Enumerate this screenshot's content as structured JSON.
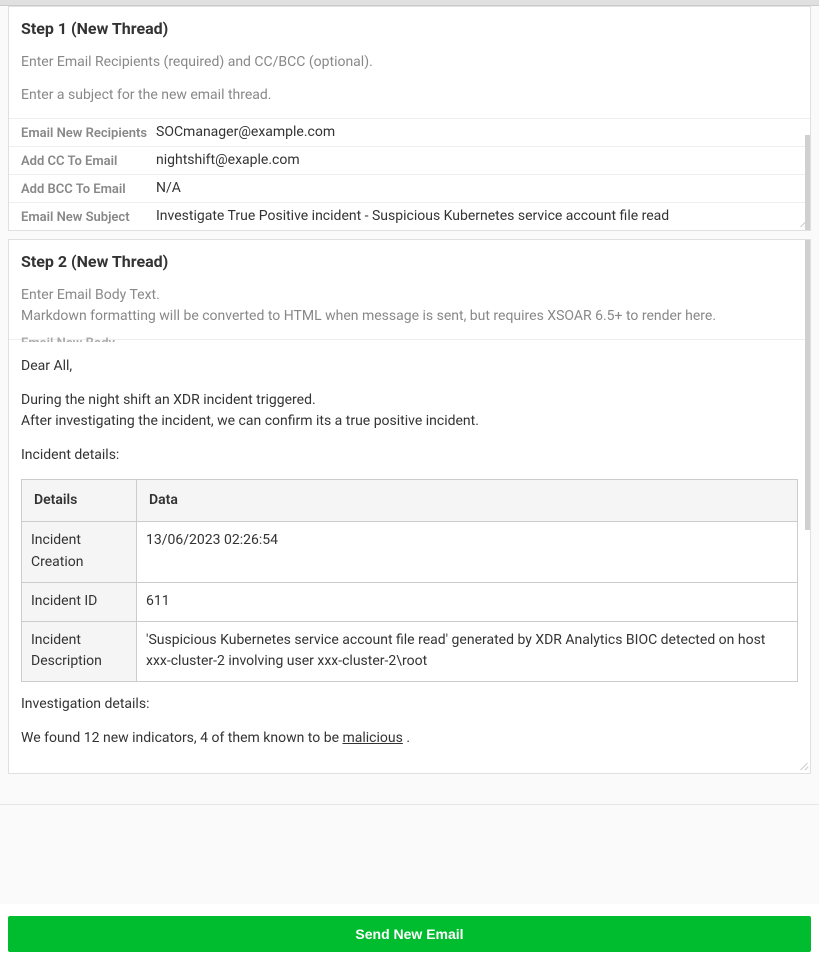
{
  "step1": {
    "title": "Step 1 (New Thread)",
    "desc1": "Enter Email Recipients (required) and CC/BCC (optional).",
    "desc2": "Enter a subject for the new email thread.",
    "fields": {
      "recipients_label": "Email New Recipients",
      "recipients_value": "SOCmanager@example.com",
      "cc_label": "Add CC To Email",
      "cc_value": "nightshift@exaple.com",
      "bcc_label": "Add BCC To Email",
      "bcc_value": "N/A",
      "subject_label": "Email New Subject",
      "subject_value": "Investigate True Positive incident - Suspicious Kubernetes service account file read"
    }
  },
  "step2": {
    "title": "Step 2 (New Thread)",
    "desc1": "Enter Email Body Text.",
    "desc2": "Markdown formatting will be converted to HTML when message is sent, but requires XSOAR 6.5+ to render here.",
    "body_label_cut": "Email New Body",
    "body": {
      "greeting": "Dear All,",
      "line1": "During the night shift an XDR incident triggered.",
      "line2": "After investigating the incident, we can confirm its a true positive incident.",
      "incident_heading": "Incident details:",
      "table_headers": {
        "col1": "Details",
        "col2": "Data"
      },
      "rows": [
        {
          "label": "Incident Creation",
          "value": "13/06/2023 02:26:54"
        },
        {
          "label": "Incident ID",
          "value": "611"
        },
        {
          "label": "Incident Description",
          "value": "'Suspicious Kubernetes service account file read' generated by XDR Analytics BIOC detected on host xxx-cluster-2 involving user xxx-cluster-2\\root"
        }
      ],
      "investigation_heading": "Investigation details:",
      "investigation_line_pre": "We found 12 new indicators, 4 of them known to be ",
      "investigation_link": "malicious",
      "investigation_line_post": " ."
    }
  },
  "send_button_label": "Send New Email"
}
